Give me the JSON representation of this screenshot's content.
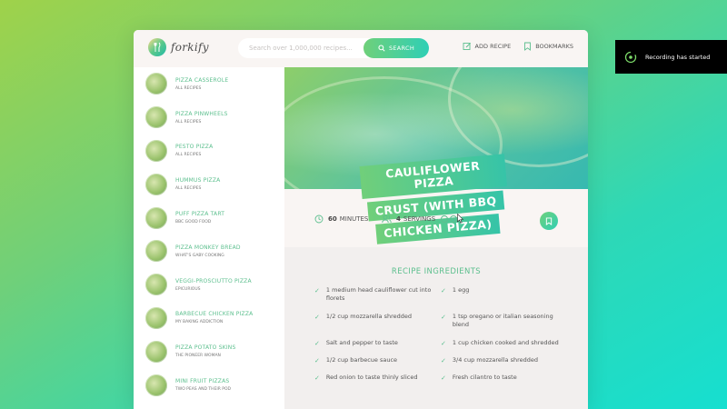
{
  "header": {
    "logo_text": "forkify",
    "search_placeholder": "Search over 1,000,000 recipes...",
    "search_button": "Search",
    "nav": {
      "add_recipe": "Add recipe",
      "bookmarks": "Bookmarks"
    }
  },
  "results": [
    {
      "title": "Pizza Casserole",
      "publisher": "All Recipes"
    },
    {
      "title": "Pizza Pinwheels",
      "publisher": "All Recipes"
    },
    {
      "title": "Pesto Pizza",
      "publisher": "All Recipes"
    },
    {
      "title": "Hummus Pizza",
      "publisher": "All Recipes"
    },
    {
      "title": "Puff Pizza Tart",
      "publisher": "BBC Good Food"
    },
    {
      "title": "Pizza Monkey Bread",
      "publisher": "What's Gaby Cooking"
    },
    {
      "title": "Veggi-Prosciutto Pizza",
      "publisher": "Epicurious"
    },
    {
      "title": "Barbecue Chicken Pizza",
      "publisher": "My Baking Addiction"
    },
    {
      "title": "Pizza Potato Skins",
      "publisher": "The Pioneer Woman"
    },
    {
      "title": "Mini Fruit Pizzas",
      "publisher": "Two Peas and Their Pod"
    }
  ],
  "recipe": {
    "title_lines": [
      "Cauliflower Pizza",
      "Crust (with BBQ",
      "Chicken Pizza)"
    ],
    "minutes_value": "60",
    "minutes_label": "minutes",
    "servings_value": "4",
    "servings_label": "servings",
    "ingredients_heading": "Recipe ingredients",
    "ingredients": [
      "1 medium head cauliflower cut into florets",
      "1 egg",
      "1/2 cup mozzarella shredded",
      "1 tsp oregano or italian seasoning blend",
      "Salt and pepper to taste",
      "1 cup chicken cooked and shredded",
      "1/2 cup barbecue sauce",
      "3/4 cup mozzarella shredded",
      "Red onion to taste thinly sliced",
      "Fresh cilantro to taste"
    ]
  },
  "toast": {
    "text": "Recording has started"
  },
  "colors": {
    "accent": "#5cbf8e",
    "gradient_start": "#6fd07a",
    "gradient_end": "#2fcfb5",
    "toast_bg": "#000000"
  },
  "icons": [
    "fork-knife-icon",
    "search-icon",
    "edit-icon",
    "bookmark-icon",
    "clock-icon",
    "users-icon",
    "minus-circle-icon",
    "plus-circle-icon",
    "cursor-icon",
    "check-icon",
    "recording-icon"
  ]
}
